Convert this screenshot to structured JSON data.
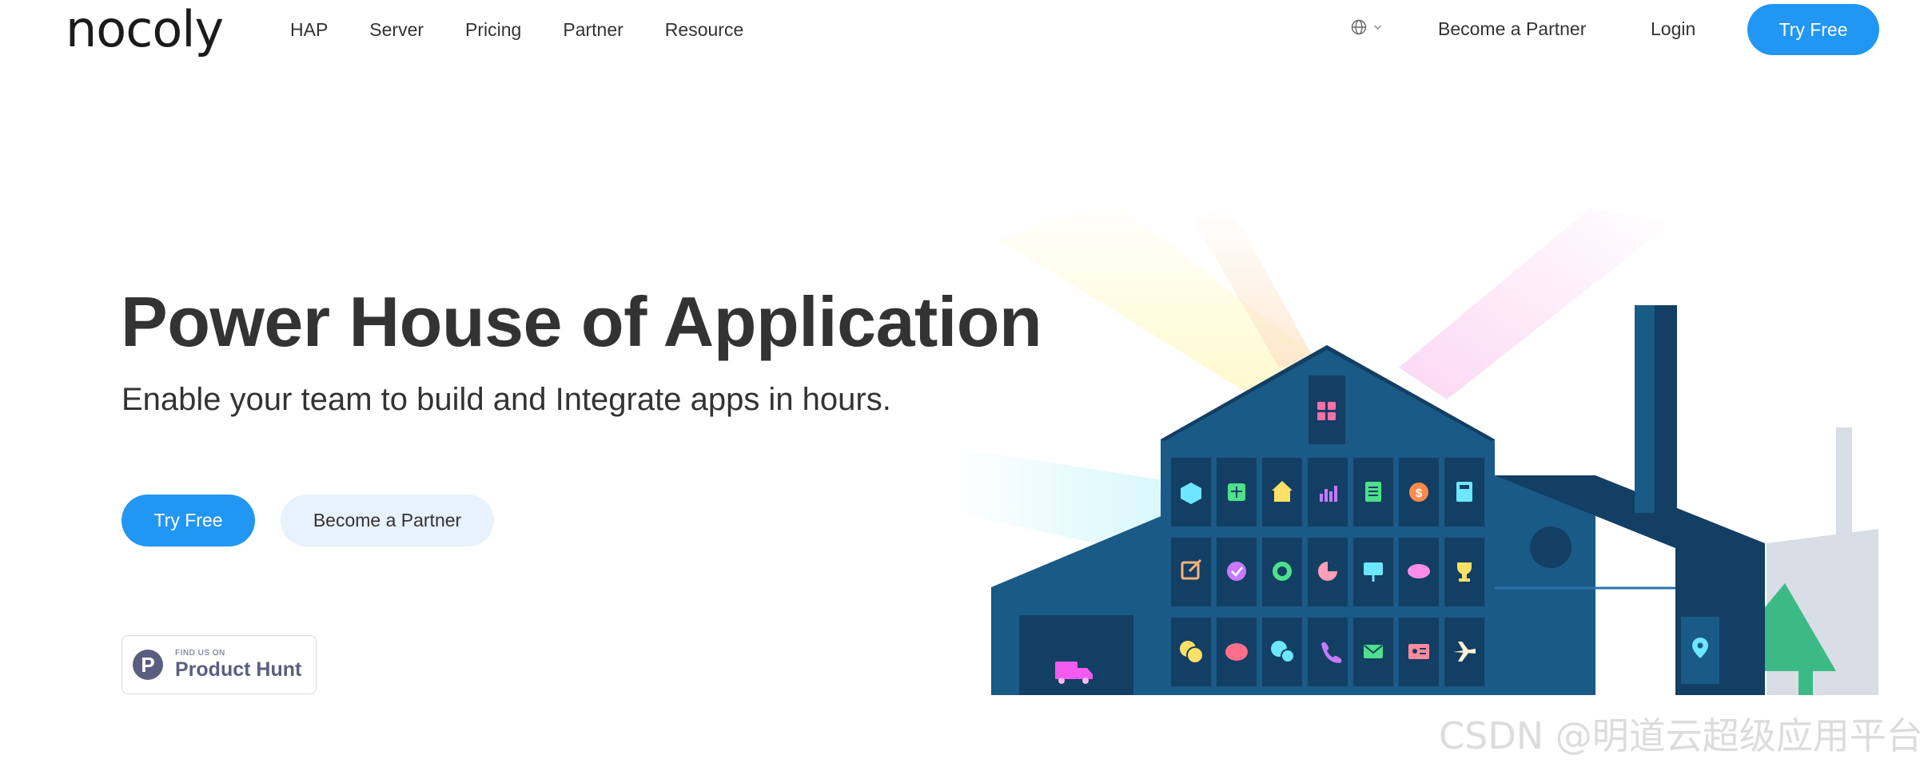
{
  "nav": {
    "logo": "nocoly",
    "links": [
      "HAP",
      "Server",
      "Pricing",
      "Partner",
      "Resource"
    ],
    "language_icon": "globe-icon",
    "become_partner": "Become a Partner",
    "login": "Login",
    "try_free": "Try Free"
  },
  "hero": {
    "title": "Power House of Application",
    "subtitle": "Enable your team to build and Integrate apps in hours.",
    "try_free": "Try Free",
    "become_partner": "Become a Partner"
  },
  "product_hunt": {
    "letter": "P",
    "small": "FIND US ON",
    "big": "Product Hunt"
  },
  "illustration": {
    "icons": [
      "cube-icon",
      "table-icon",
      "home-icon",
      "chart-icon",
      "document-icon",
      "dollar-icon",
      "calculator-icon",
      "edit-icon",
      "badge-icon",
      "globe-icon",
      "pie-chart-icon",
      "presentation-icon",
      "handshake-icon",
      "trophy-icon",
      "coins-icon",
      "piggy-bank-icon",
      "chat-icon",
      "phone-icon",
      "mail-icon",
      "contact-card-icon",
      "plane-icon"
    ],
    "colors": {
      "building": "#1a5a86",
      "building_dark": "#123f63",
      "accent_blue": "#2196f3",
      "tree": "#3cba85"
    }
  },
  "watermark": "CSDN @明道云超级应用平台"
}
